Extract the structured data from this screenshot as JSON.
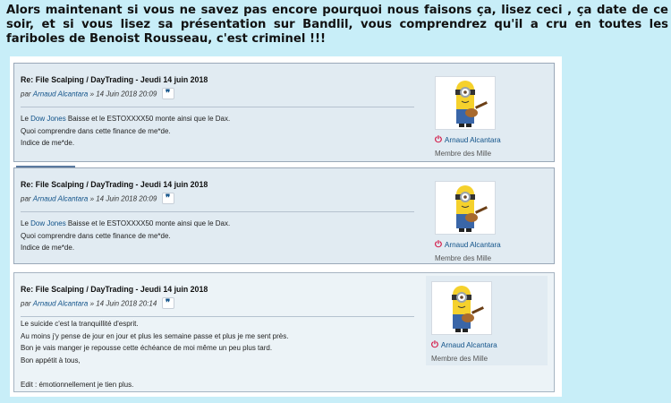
{
  "headline": "Alors maintenant si vous ne savez pas encore pourquoi nous faisons ça, lisez ceci , ça date de ce soir, et si vous lisez sa présentation sur Bandlil, vous comprendrez qu'il a cru en toutes les fariboles de Benoist Rousseau, c'est criminel !!!",
  "posts": [
    {
      "title": "Re: File Scalping / DayTrading - Jeudi 14 juin 2018",
      "by": "par",
      "author": "Arnaud Alcantara",
      "date": "» 14 Juin 2018 20:09",
      "line1_pre": "Le ",
      "line1_link": "Dow Jones",
      "line1_post": " Baisse et le ESTOXXXX50 monte ainsi que le Dax.",
      "line2": "Quoi comprendre dans cette finance de me*de.",
      "line3": "Indice de me*de.",
      "profile_name": "Arnaud Alcantara",
      "profile_rank": "Membre des Mille"
    },
    {
      "title": "Re: File Scalping / DayTrading - Jeudi 14 juin 2018",
      "by": "par",
      "author": "Arnaud Alcantara",
      "date": "» 14 Juin 2018 20:09",
      "line1_pre": "Le ",
      "line1_link": "Dow Jones",
      "line1_post": " Baisse et le ESTOXXXX50 monte ainsi que le Dax.",
      "line2": "Quoi comprendre dans cette finance de me*de.",
      "line3": "Indice de me*de.",
      "profile_name": "Arnaud Alcantara",
      "profile_rank": "Membre des Mille"
    },
    {
      "title": "Re: File Scalping / DayTrading - Jeudi 14 juin 2018",
      "by": "par",
      "author": "Arnaud Alcantara",
      "date": "» 14 Juin 2018 20:14",
      "lines": [
        "Le suicide c'est la tranquillité d'esprit.",
        "Au moins j'y pense de jour en jour et plus les semaine passe et plus je me sent près.",
        "Bon je vais manger je repousse cette échéance de moi même un peu plus tard.",
        "Bon appétit à tous,",
        "",
        "Edit : émotionnellement je tien plus."
      ],
      "profile_name": "Arnaud Alcantara",
      "profile_rank": "Membre des Mille"
    }
  ],
  "icons": {
    "quote": "quote-icon",
    "online": "power-icon",
    "avatar": "minion-avatar-icon"
  },
  "colors": {
    "background": "#c8eef8",
    "post_bg": "#e1ebf2",
    "link": "#105289",
    "online": "#d31141"
  }
}
